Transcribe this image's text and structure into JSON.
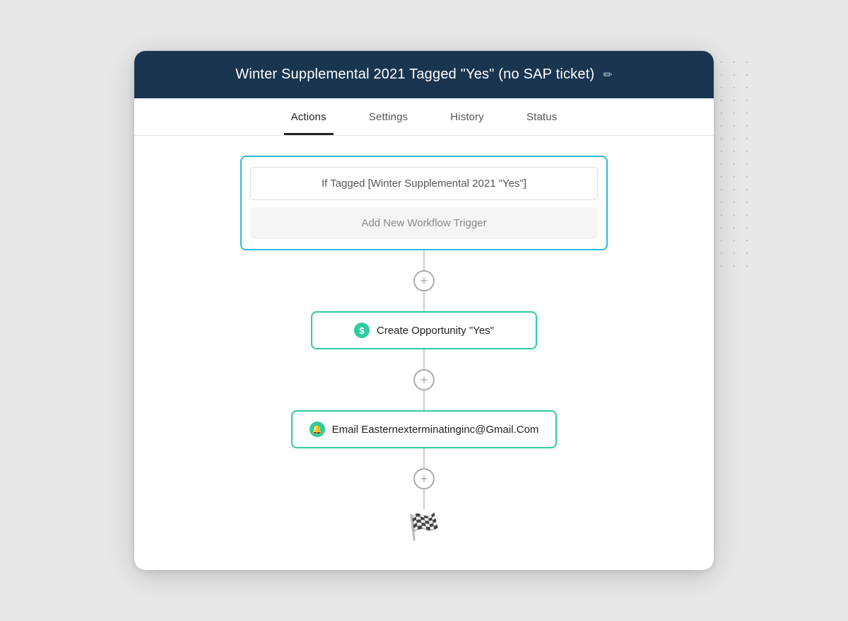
{
  "header": {
    "title": "Winter Supplemental 2021 Tagged \"Yes\" (no SAP ticket)",
    "edit_icon": "✏"
  },
  "tabs": [
    {
      "label": "Actions",
      "active": true
    },
    {
      "label": "Settings",
      "active": false
    },
    {
      "label": "History",
      "active": false
    },
    {
      "label": "Status",
      "active": false
    }
  ],
  "trigger": {
    "condition_text": "If Tagged [Winter Supplemental 2021 \"Yes\"]",
    "add_trigger_label": "Add New Workflow Trigger"
  },
  "actions": [
    {
      "icon_type": "dollar",
      "icon_label": "$",
      "label": "Create Opportunity \"Yes\""
    },
    {
      "icon_type": "bell",
      "icon_label": "🔔",
      "label": "Email Easternexterminatinginc@Gmail.Com"
    }
  ],
  "connectors": {
    "add_label": "+"
  },
  "finish": {
    "icon": "🏁"
  }
}
